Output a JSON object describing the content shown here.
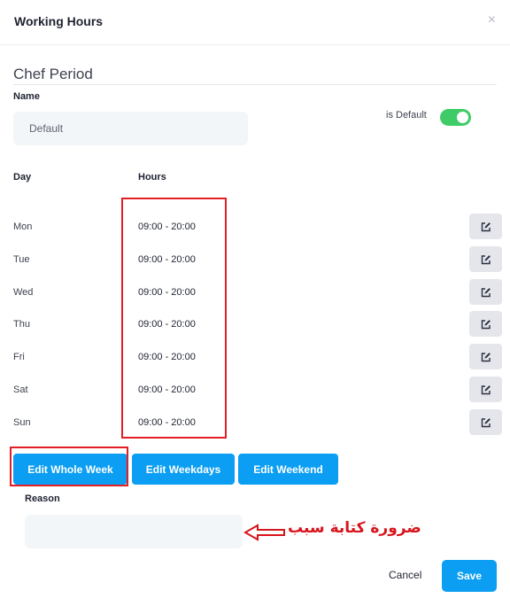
{
  "dialog": {
    "title": "Working Hours",
    "close_icon": "×"
  },
  "section": {
    "title": "Chef Period"
  },
  "form": {
    "name_label": "Name",
    "name_value": "Default",
    "is_default_label": "is Default",
    "is_default_on": true,
    "toggle_color": "#3fcb67"
  },
  "table": {
    "day_header": "Day",
    "hours_header": "Hours",
    "rows": [
      {
        "day": "Mon",
        "hours": "09:00 - 20:00"
      },
      {
        "day": "Tue",
        "hours": "09:00 - 20:00"
      },
      {
        "day": "Wed",
        "hours": "09:00 - 20:00"
      },
      {
        "day": "Thu",
        "hours": "09:00 - 20:00"
      },
      {
        "day": "Fri",
        "hours": "09:00 - 20:00"
      },
      {
        "day": "Sat",
        "hours": "09:00 - 20:00"
      },
      {
        "day": "Sun",
        "hours": "09:00 - 20:00"
      }
    ]
  },
  "actions": {
    "edit_whole_week": "Edit Whole Week",
    "edit_weekdays": "Edit Weekdays",
    "edit_weekend": "Edit Weekend"
  },
  "reason": {
    "label": "Reason",
    "value": ""
  },
  "annotation": {
    "text": "ضرورة كتابة سبب",
    "color": "#d7141c"
  },
  "footer": {
    "cancel_label": "Cancel",
    "save_label": "Save"
  },
  "colors": {
    "primary": "#0b9ef2",
    "highlight": "#e31e24"
  }
}
